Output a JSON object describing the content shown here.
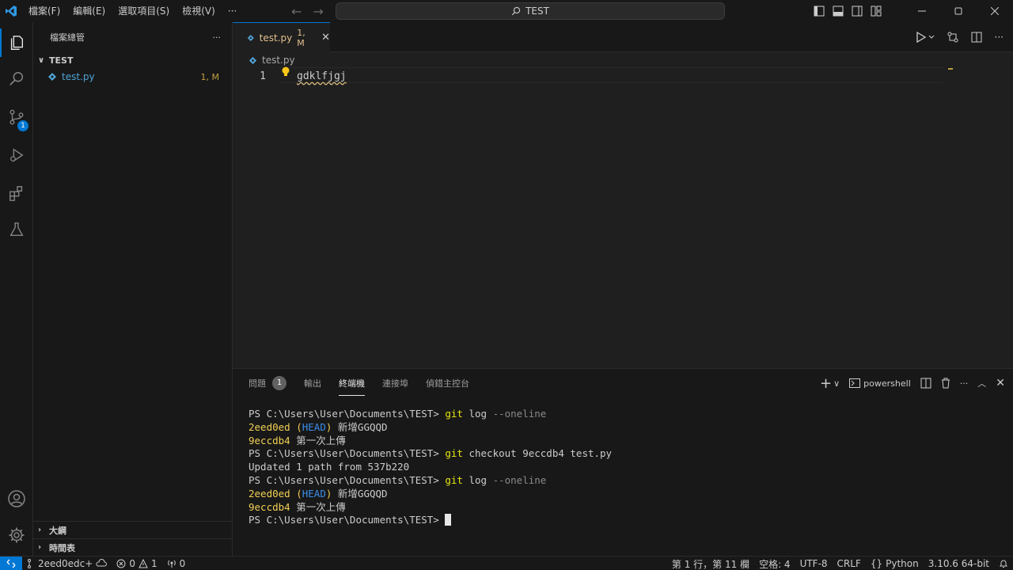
{
  "titlebar": {
    "menu": [
      "檔案(F)",
      "編輯(E)",
      "選取項目(S)",
      "檢視(V)",
      "···"
    ],
    "search": "TEST"
  },
  "activity": {
    "scm_badge": "1"
  },
  "sidebar": {
    "title": "檔案總管",
    "more": "···",
    "folder": "TEST",
    "files": [
      {
        "name": "test.py",
        "status": "1, M"
      }
    ],
    "outline": "大綱",
    "timeline": "時間表"
  },
  "editor": {
    "tab": {
      "label": "test.py",
      "status": "1, M",
      "close": "✕"
    },
    "breadcrumb": "test.py",
    "lines": [
      {
        "no": "1",
        "text": "gdklfjgj"
      }
    ]
  },
  "panel": {
    "tabs": [
      "問題",
      "輸出",
      "終端機",
      "連接埠",
      "偵錯主控台"
    ],
    "problems_badge": "1",
    "active_tab": "終端機",
    "shell": "powershell",
    "terminal": [
      {
        "prompt": "PS C:\\Users\\User\\Documents\\TEST> ",
        "cmd": "git",
        "args": " log ",
        "flag": "--oneline"
      },
      {
        "hash": "2eed0ed",
        "ref_open": " (",
        "ref": "HEAD",
        "ref_close": ") ",
        "msg": "新增GGQQD"
      },
      {
        "hash": "9eccdb4",
        "msg": " 第一次上傳"
      },
      {
        "prompt": "PS C:\\Users\\User\\Documents\\TEST> ",
        "cmd": "git",
        "args": " checkout 9eccdb4 test.py"
      },
      {
        "plain": "Updated 1 path from 537b220"
      },
      {
        "prompt": "PS C:\\Users\\User\\Documents\\TEST> ",
        "cmd": "git",
        "args": " log ",
        "flag": "--oneline"
      },
      {
        "hash": "2eed0ed",
        "ref_open": " (",
        "ref": "HEAD",
        "ref_close": ") ",
        "msg": "新增GGQQD"
      },
      {
        "hash": "9eccdb4",
        "msg": " 第一次上傳"
      },
      {
        "prompt": "PS C:\\Users\\User\\Documents\\TEST> "
      }
    ]
  },
  "statusbar": {
    "branch": "2eed0edc+",
    "errors": "0",
    "warnings": "1",
    "ports": "0",
    "position": "第 1 行，第 11 欄",
    "spaces": "空格: 4",
    "encoding": "UTF-8",
    "eol": "CRLF",
    "language": "Python",
    "interpreter": "3.10.6 64-bit"
  },
  "colors": {
    "accent": "#0078d4",
    "modified": "#e2c08d",
    "background": "#1f1f1f"
  }
}
